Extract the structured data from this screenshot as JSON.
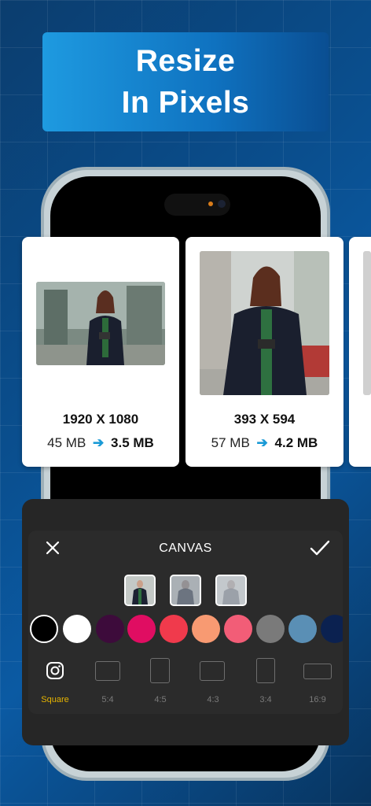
{
  "banner": {
    "title": "Resize\nIn Pixels"
  },
  "cards": [
    {
      "dimensions": "1920 X 1080",
      "old_size": "45 MB",
      "arrow": "➔",
      "new_size": "3.5 MB"
    },
    {
      "dimensions": "393 X 594",
      "old_size": "57 MB",
      "arrow": "➔",
      "new_size": "4.2 MB"
    }
  ],
  "editor": {
    "title": "CANVAS",
    "close_icon": "close-icon",
    "confirm_icon": "check-icon",
    "background_thumbnails": [
      "original",
      "blur",
      "blur-light"
    ],
    "colors": [
      "#000000",
      "#ffffff",
      "#3d0b3b",
      "#e00d62",
      "#f03a4c",
      "#f89a72",
      "#f25d77",
      "#7a7a7a",
      "#5a8fb5",
      "#0b2150"
    ],
    "ratios": [
      {
        "label": "Square",
        "icon": "instagram-icon",
        "active": true
      },
      {
        "label": "5:4",
        "active": false
      },
      {
        "label": "4:5",
        "active": false
      },
      {
        "label": "4:3",
        "active": false
      },
      {
        "label": "3:4",
        "active": false
      },
      {
        "label": "16:9",
        "active": false
      }
    ]
  },
  "colors": {
    "accent": "#1a9ad6",
    "active_ratio": "#e6b400",
    "panel": "#262626"
  }
}
